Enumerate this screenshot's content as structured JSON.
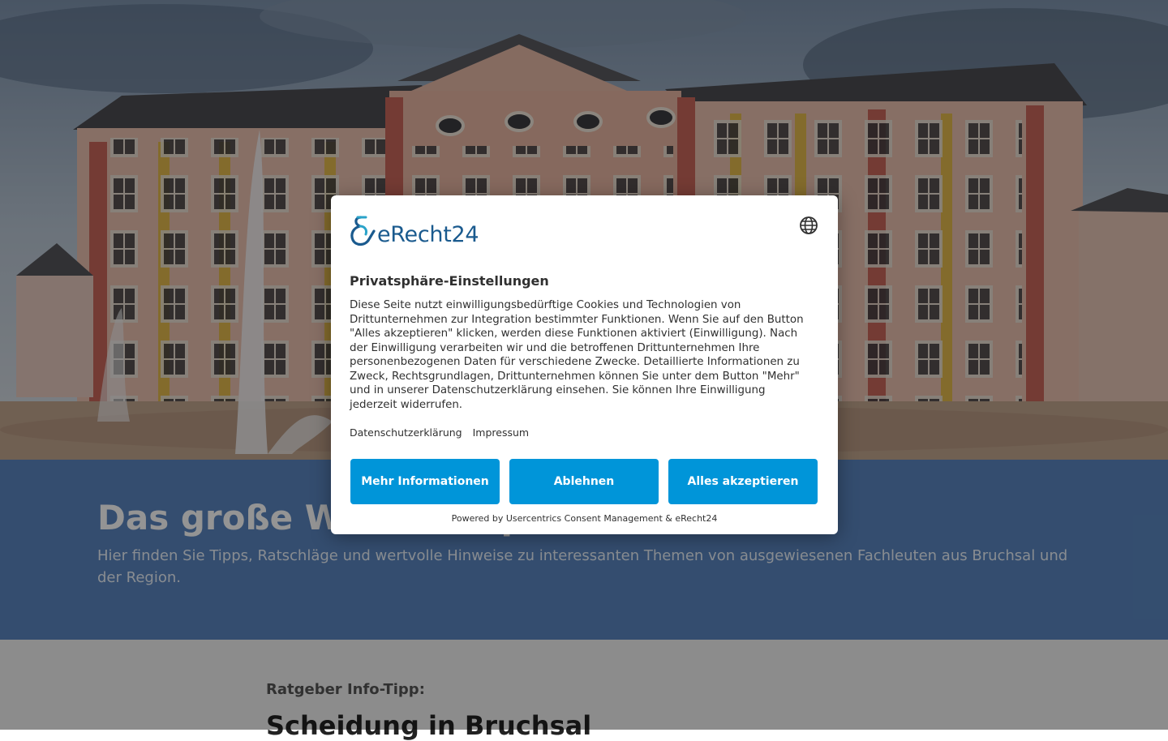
{
  "hero": {
    "alt": "Schloss Bruchsal"
  },
  "intro": {
    "title": "Das große Wissens-Spezial",
    "subtitle": "Hier finden Sie Tipps, Ratschläge und wertvolle Hinweise zu interessanten Themen von ausgewiesenen Fachleuten aus Bruchsal und der Region."
  },
  "article": {
    "kicker": "Ratgeber Info-Tipp:",
    "headline": "Scheidung in Bruchsal"
  },
  "consent": {
    "brand": "eRecht24",
    "language_icon": "globe-icon",
    "title": "Privatsphäre-Einstellungen",
    "body": "Diese Seite nutzt einwilligungsbedürftige Cookies und Technologien von Drittunternehmen zur Integration bestimmter Funktionen. Wenn Sie auf den Button \"Alles akzeptieren\" klicken, werden diese Funktionen aktiviert (Einwilligung). Nach der Einwilligung verarbeiten wir und die betroffenen Drittunternehmen Ihre personenbezogenen Daten für verschiedene Zwecke. Detaillierte Informationen zu Zweck, Rechtsgrundlagen, Drittunternehmen können Sie unter dem Button \"Mehr\" und in unserer Datenschutzerklärung einsehen. Sie können Ihre Einwilligung jederzeit widerrufen.",
    "links": {
      "privacy": "Datenschutzerklärung",
      "imprint": "Impressum"
    },
    "buttons": {
      "more": "Mehr Informationen",
      "deny": "Ablehnen",
      "accept": "Alles akzeptieren"
    },
    "powered_by": "Powered by Usercentrics Consent Management & eRecht24",
    "colors": {
      "button": "#0095d9",
      "brand": "#1a5a8e"
    }
  }
}
